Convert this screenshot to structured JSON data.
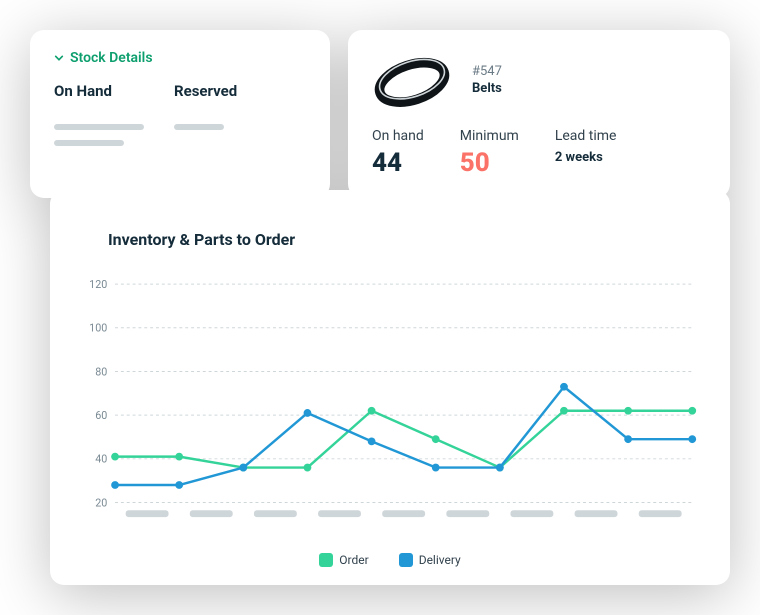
{
  "stock_card": {
    "title": "Stock Details",
    "col_on_hand": "On Hand",
    "col_reserved": "Reserved"
  },
  "item_card": {
    "sku": "#547",
    "name": "Belts",
    "on_hand_label": "On hand",
    "on_hand_value": "44",
    "minimum_label": "Minimum",
    "minimum_value": "50",
    "lead_label": "Lead time",
    "lead_value": "2 weeks"
  },
  "chart": {
    "title": "Inventory & Parts to Order",
    "legend_order": "Order",
    "legend_delivery": "Delivery"
  },
  "colors": {
    "order": "#34d399",
    "delivery": "#2198d5"
  },
  "chart_data": {
    "type": "line",
    "title": "Inventory & Parts to Order",
    "xlabel": "",
    "ylabel": "",
    "ylim": [
      20,
      120
    ],
    "y_ticks": [
      20,
      40,
      60,
      80,
      100,
      120
    ],
    "categories": [
      "",
      "",
      "",
      "",
      "",
      "",
      "",
      "",
      ""
    ],
    "x": [
      0,
      1,
      2,
      3,
      4,
      5,
      6,
      7,
      8
    ],
    "series": [
      {
        "name": "Order",
        "color": "#34d399",
        "values": [
          41,
          41,
          36,
          36,
          62,
          49,
          36,
          62,
          62,
          62
        ]
      },
      {
        "name": "Delivery",
        "color": "#2198d5",
        "values": [
          28,
          28,
          36,
          61,
          48,
          36,
          36,
          73,
          49,
          49
        ]
      }
    ],
    "legend_position": "bottom",
    "grid": true
  }
}
